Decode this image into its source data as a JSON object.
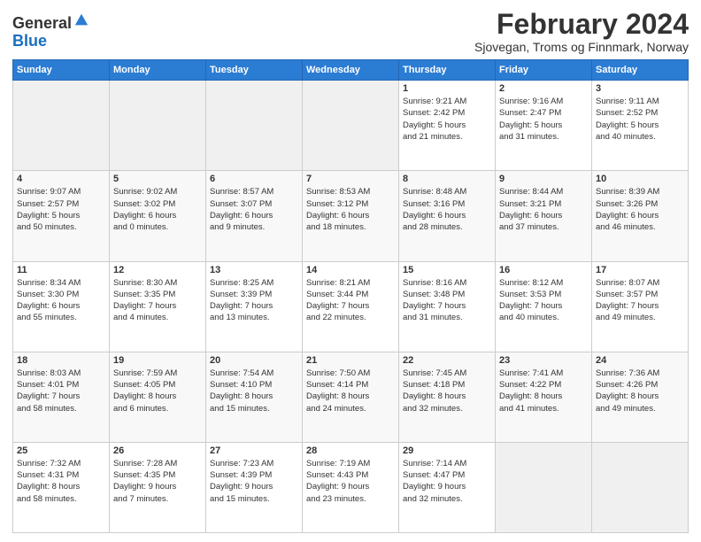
{
  "logo": {
    "general": "General",
    "blue": "Blue"
  },
  "header": {
    "title": "February 2024",
    "subtitle": "Sjovegan, Troms og Finnmark, Norway"
  },
  "days": [
    "Sunday",
    "Monday",
    "Tuesday",
    "Wednesday",
    "Thursday",
    "Friday",
    "Saturday"
  ],
  "weeks": [
    [
      {
        "day": "",
        "content": ""
      },
      {
        "day": "",
        "content": ""
      },
      {
        "day": "",
        "content": ""
      },
      {
        "day": "",
        "content": ""
      },
      {
        "day": "1",
        "content": "Sunrise: 9:21 AM\nSunset: 2:42 PM\nDaylight: 5 hours\nand 21 minutes."
      },
      {
        "day": "2",
        "content": "Sunrise: 9:16 AM\nSunset: 2:47 PM\nDaylight: 5 hours\nand 31 minutes."
      },
      {
        "day": "3",
        "content": "Sunrise: 9:11 AM\nSunset: 2:52 PM\nDaylight: 5 hours\nand 40 minutes."
      }
    ],
    [
      {
        "day": "4",
        "content": "Sunrise: 9:07 AM\nSunset: 2:57 PM\nDaylight: 5 hours\nand 50 minutes."
      },
      {
        "day": "5",
        "content": "Sunrise: 9:02 AM\nSunset: 3:02 PM\nDaylight: 6 hours\nand 0 minutes."
      },
      {
        "day": "6",
        "content": "Sunrise: 8:57 AM\nSunset: 3:07 PM\nDaylight: 6 hours\nand 9 minutes."
      },
      {
        "day": "7",
        "content": "Sunrise: 8:53 AM\nSunset: 3:12 PM\nDaylight: 6 hours\nand 18 minutes."
      },
      {
        "day": "8",
        "content": "Sunrise: 8:48 AM\nSunset: 3:16 PM\nDaylight: 6 hours\nand 28 minutes."
      },
      {
        "day": "9",
        "content": "Sunrise: 8:44 AM\nSunset: 3:21 PM\nDaylight: 6 hours\nand 37 minutes."
      },
      {
        "day": "10",
        "content": "Sunrise: 8:39 AM\nSunset: 3:26 PM\nDaylight: 6 hours\nand 46 minutes."
      }
    ],
    [
      {
        "day": "11",
        "content": "Sunrise: 8:34 AM\nSunset: 3:30 PM\nDaylight: 6 hours\nand 55 minutes."
      },
      {
        "day": "12",
        "content": "Sunrise: 8:30 AM\nSunset: 3:35 PM\nDaylight: 7 hours\nand 4 minutes."
      },
      {
        "day": "13",
        "content": "Sunrise: 8:25 AM\nSunset: 3:39 PM\nDaylight: 7 hours\nand 13 minutes."
      },
      {
        "day": "14",
        "content": "Sunrise: 8:21 AM\nSunset: 3:44 PM\nDaylight: 7 hours\nand 22 minutes."
      },
      {
        "day": "15",
        "content": "Sunrise: 8:16 AM\nSunset: 3:48 PM\nDaylight: 7 hours\nand 31 minutes."
      },
      {
        "day": "16",
        "content": "Sunrise: 8:12 AM\nSunset: 3:53 PM\nDaylight: 7 hours\nand 40 minutes."
      },
      {
        "day": "17",
        "content": "Sunrise: 8:07 AM\nSunset: 3:57 PM\nDaylight: 7 hours\nand 49 minutes."
      }
    ],
    [
      {
        "day": "18",
        "content": "Sunrise: 8:03 AM\nSunset: 4:01 PM\nDaylight: 7 hours\nand 58 minutes."
      },
      {
        "day": "19",
        "content": "Sunrise: 7:59 AM\nSunset: 4:05 PM\nDaylight: 8 hours\nand 6 minutes."
      },
      {
        "day": "20",
        "content": "Sunrise: 7:54 AM\nSunset: 4:10 PM\nDaylight: 8 hours\nand 15 minutes."
      },
      {
        "day": "21",
        "content": "Sunrise: 7:50 AM\nSunset: 4:14 PM\nDaylight: 8 hours\nand 24 minutes."
      },
      {
        "day": "22",
        "content": "Sunrise: 7:45 AM\nSunset: 4:18 PM\nDaylight: 8 hours\nand 32 minutes."
      },
      {
        "day": "23",
        "content": "Sunrise: 7:41 AM\nSunset: 4:22 PM\nDaylight: 8 hours\nand 41 minutes."
      },
      {
        "day": "24",
        "content": "Sunrise: 7:36 AM\nSunset: 4:26 PM\nDaylight: 8 hours\nand 49 minutes."
      }
    ],
    [
      {
        "day": "25",
        "content": "Sunrise: 7:32 AM\nSunset: 4:31 PM\nDaylight: 8 hours\nand 58 minutes."
      },
      {
        "day": "26",
        "content": "Sunrise: 7:28 AM\nSunset: 4:35 PM\nDaylight: 9 hours\nand 7 minutes."
      },
      {
        "day": "27",
        "content": "Sunrise: 7:23 AM\nSunset: 4:39 PM\nDaylight: 9 hours\nand 15 minutes."
      },
      {
        "day": "28",
        "content": "Sunrise: 7:19 AM\nSunset: 4:43 PM\nDaylight: 9 hours\nand 23 minutes."
      },
      {
        "day": "29",
        "content": "Sunrise: 7:14 AM\nSunset: 4:47 PM\nDaylight: 9 hours\nand 32 minutes."
      },
      {
        "day": "",
        "content": ""
      },
      {
        "day": "",
        "content": ""
      }
    ]
  ]
}
